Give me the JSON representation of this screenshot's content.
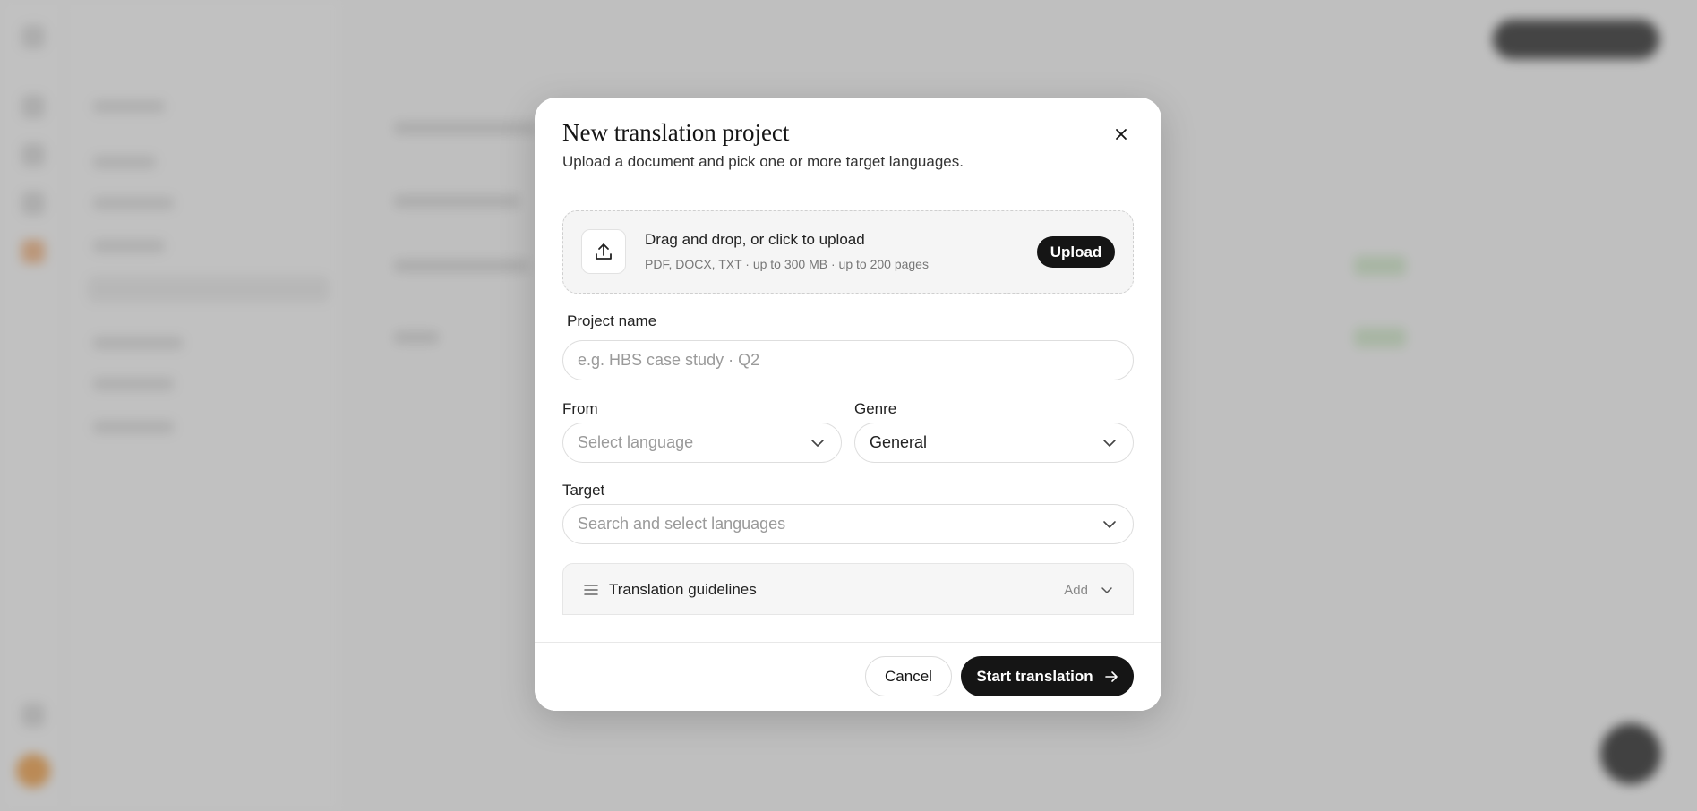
{
  "modal": {
    "title": "New translation project",
    "subtitle": "Upload a document and pick one or more target languages.",
    "close_icon": "close-icon"
  },
  "upload": {
    "icon": "upload-icon",
    "title": "Drag and drop, or click to upload",
    "hint": "PDF, DOCX, TXT · up to 300 MB · up to 200 pages",
    "button_label": "Upload"
  },
  "project_name": {
    "label": "Project name",
    "value": "",
    "placeholder": "e.g. HBS case study · Q2"
  },
  "from": {
    "label": "From",
    "placeholder": "Select language",
    "value": ""
  },
  "genre": {
    "label": "Genre",
    "value": "General"
  },
  "target": {
    "label": "Target",
    "placeholder": "Search and select languages",
    "value": ""
  },
  "guidelines": {
    "icon": "list-icon",
    "label": "Translation guidelines",
    "action_label": "Add"
  },
  "footer": {
    "cancel_label": "Cancel",
    "start_label": "Start translation",
    "start_icon": "arrow-right-icon"
  },
  "colors": {
    "primary": "#151515",
    "overlay": "#787878",
    "surface": "#ffffff"
  }
}
